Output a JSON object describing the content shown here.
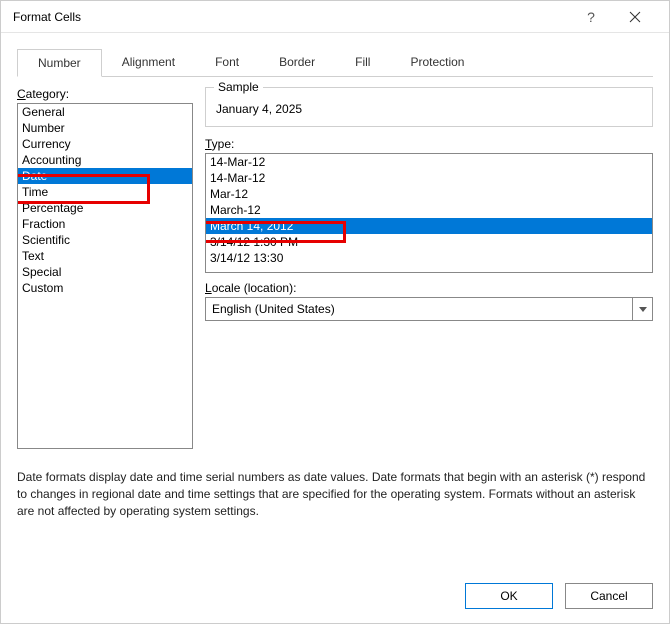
{
  "title": "Format Cells",
  "tabs": [
    "Number",
    "Alignment",
    "Font",
    "Border",
    "Fill",
    "Protection"
  ],
  "active_tab": "Number",
  "category_label": "Category:",
  "categories": [
    "General",
    "Number",
    "Currency",
    "Accounting",
    "Date",
    "Time",
    "Percentage",
    "Fraction",
    "Scientific",
    "Text",
    "Special",
    "Custom"
  ],
  "selected_category": "Date",
  "sample_label": "Sample",
  "sample_value": "January 4, 2025",
  "type_label": "Type:",
  "types": [
    "14-Mar-12",
    "14-Mar-12",
    "Mar-12",
    "March-12",
    "March 14, 2012",
    "3/14/12 1:30 PM",
    "3/14/12 13:30"
  ],
  "selected_type": "March 14, 2012",
  "locale_label": "Locale (location):",
  "locale_value": "English (United States)",
  "description": "Date formats display date and time serial numbers as date values.  Date formats that begin with an asterisk (*) respond to changes in regional date and time settings that are specified for the operating system. Formats without an asterisk are not affected by operating system settings.",
  "buttons": {
    "ok": "OK",
    "cancel": "Cancel"
  }
}
